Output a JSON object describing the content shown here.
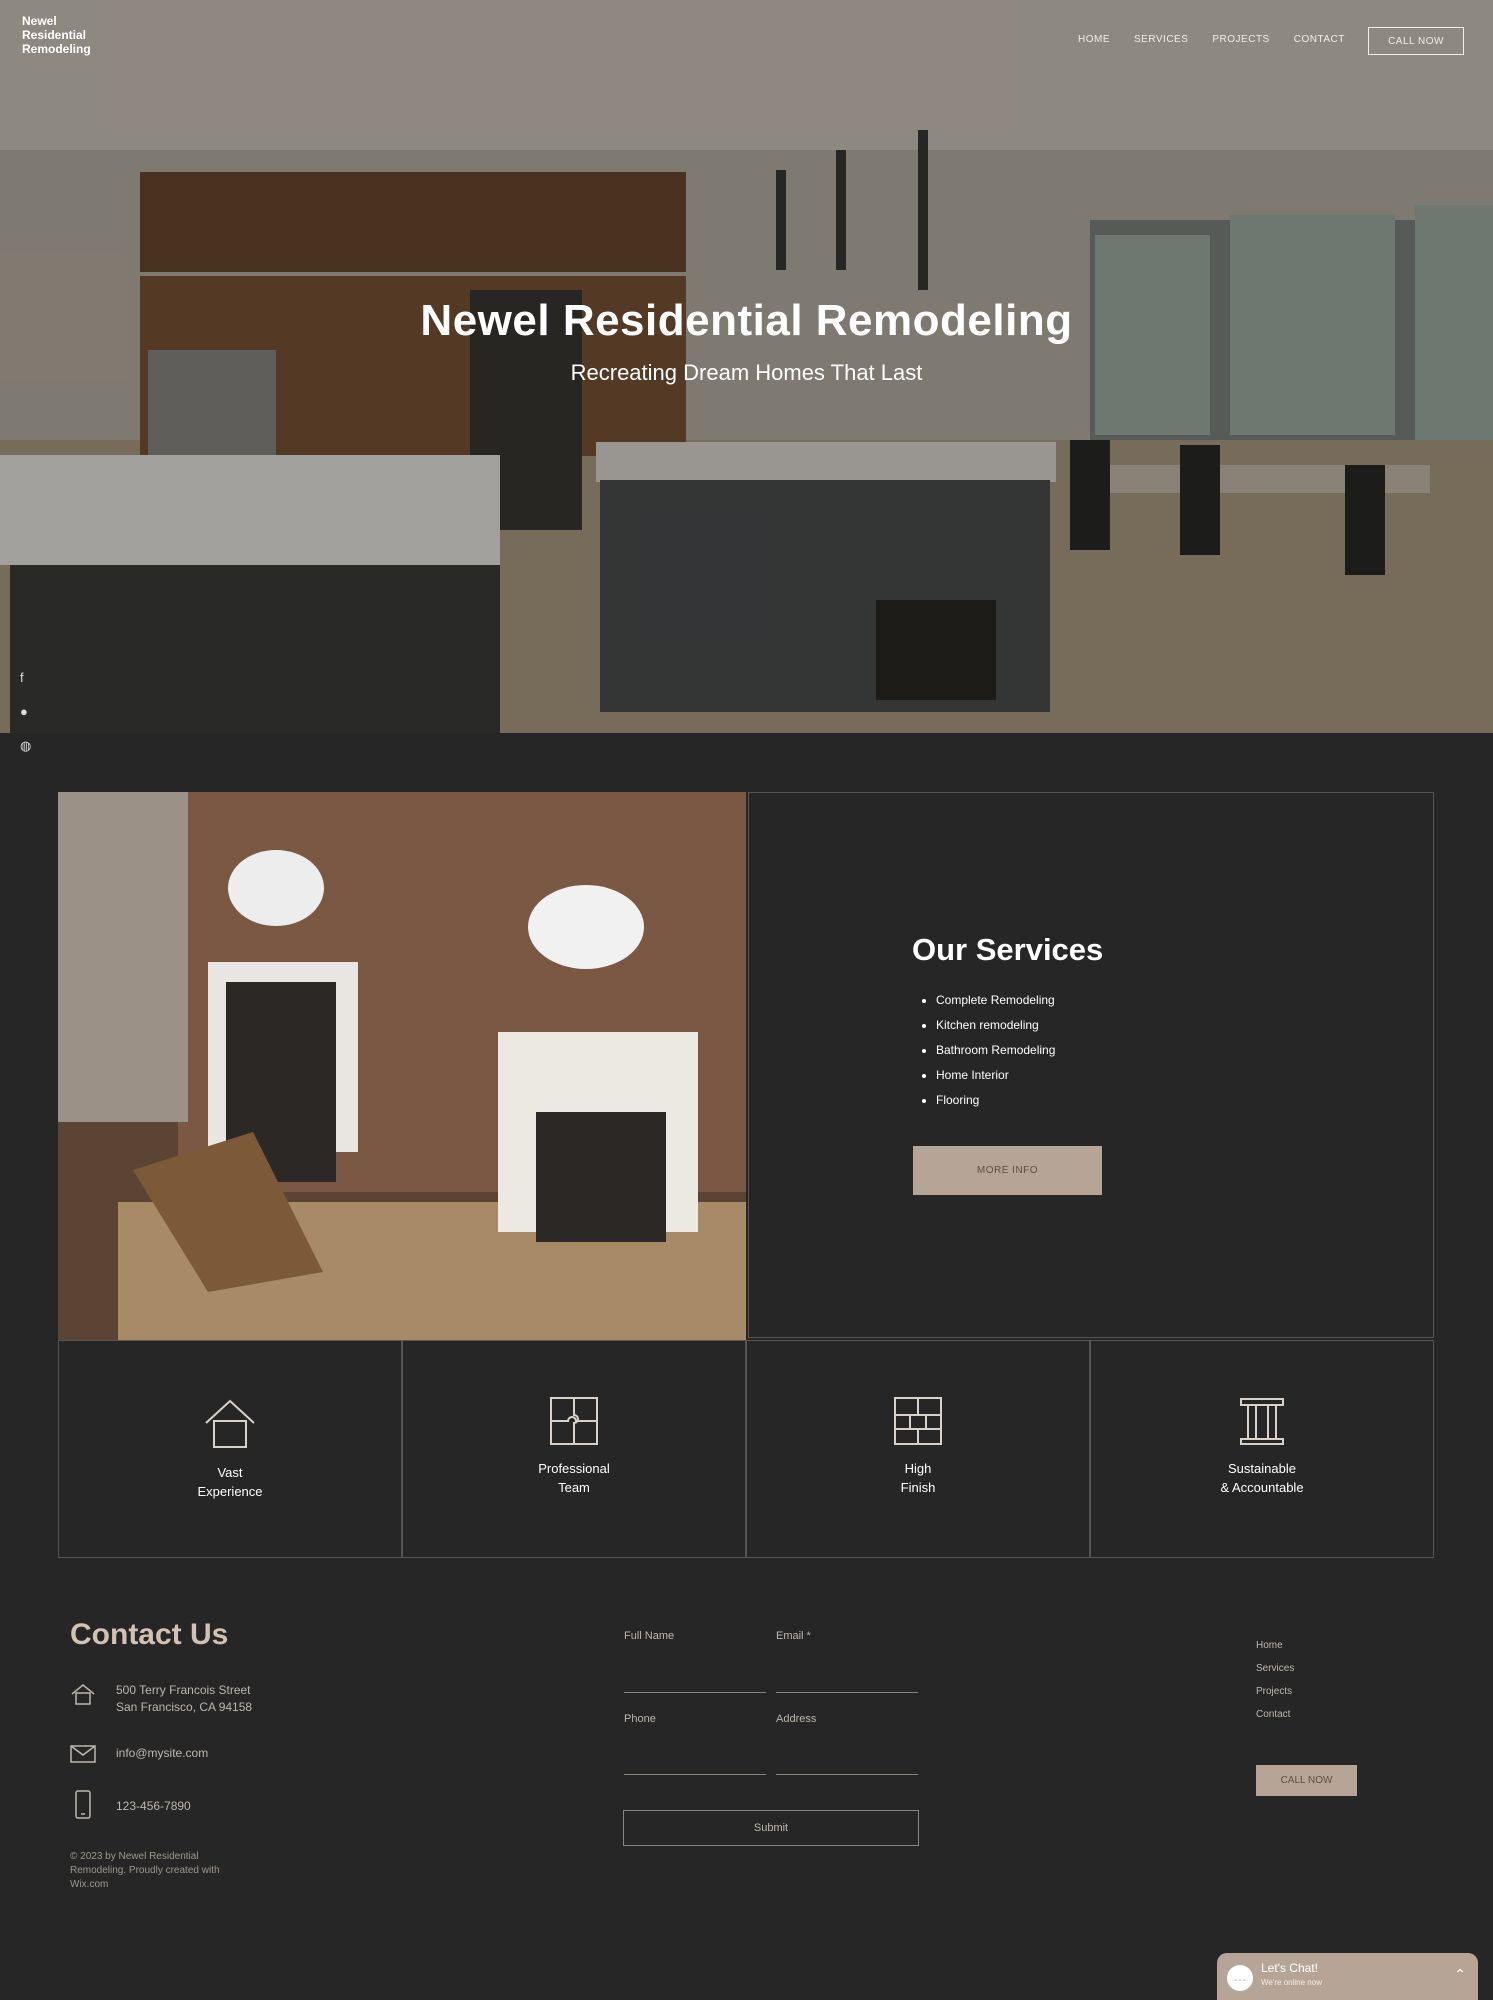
{
  "header": {
    "logo": "Newel\nResidential\nRemodeling",
    "nav": [
      "HOME",
      "SERVICES",
      "PROJECTS",
      "CONTACT"
    ],
    "call_button": "CALL NOW"
  },
  "hero": {
    "title": "Newel Residential Remodeling",
    "subtitle": "Recreating Dream Homes That Last"
  },
  "social": [
    "facebook-icon",
    "pinterest-icon",
    "instagram-icon"
  ],
  "services": {
    "title": "Our Services",
    "items": [
      "Complete Remodeling",
      "Kitchen remodeling",
      "Bathroom Remodeling",
      "Home Interior",
      "Flooring"
    ],
    "button": "MORE INFO"
  },
  "features": [
    {
      "label": "Vast\nExperience",
      "icon": "house-icon"
    },
    {
      "label": "Professional\nTeam",
      "icon": "puzzle-icon"
    },
    {
      "label": "High\nFinish",
      "icon": "tiles-icon"
    },
    {
      "label": "Sustainable\n& Accountable",
      "icon": "column-icon"
    }
  ],
  "contact": {
    "title": "Contact Us",
    "address": "500 Terry Francois Street\nSan Francisco, CA 94158",
    "email": "info@mysite.com",
    "phone": "123-456-7890",
    "copyright": "© 2023 by Newel Residential Remodeling. Proudly created with Wix.com",
    "form": {
      "full_name": "Full Name",
      "email": "Email *",
      "phone": "Phone",
      "address": "Address",
      "submit": "Submit"
    }
  },
  "footer_links": [
    "Home",
    "Services",
    "Projects",
    "Contact"
  ],
  "footer_call": "CALL NOW",
  "chat": {
    "title": "Let's Chat!",
    "subtitle": "We're online now"
  }
}
